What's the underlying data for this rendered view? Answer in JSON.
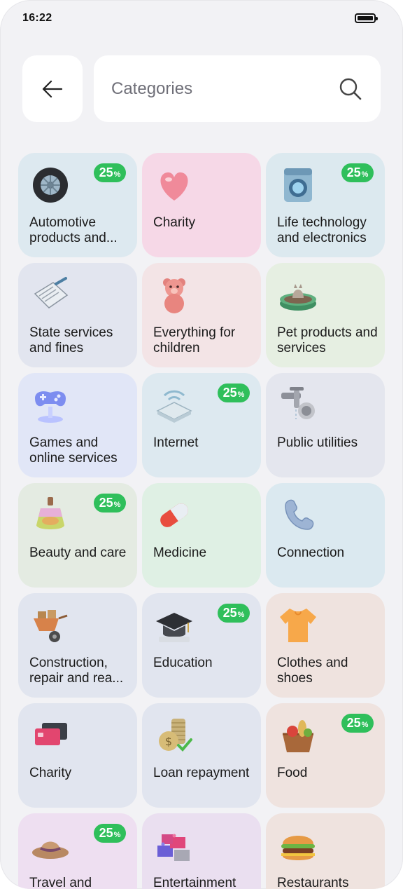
{
  "status_bar": {
    "time": "16:22"
  },
  "header": {
    "search_placeholder": "Categories"
  },
  "categories": [
    {
      "label": "Automotive products and...",
      "badge": "25",
      "badge_unit": "%",
      "bg": "#dde9f0",
      "icon": "tire-icon"
    },
    {
      "label": "Charity",
      "bg": "#f6d8e7",
      "icon": "heart-icon"
    },
    {
      "label": "Life technology and electronics",
      "badge": "25",
      "badge_unit": "%",
      "bg": "#dce9ef",
      "icon": "washing-machine-icon"
    },
    {
      "label": "State services and fines",
      "bg": "#e2e5ef",
      "icon": "document-pen-icon"
    },
    {
      "label": "Everything for children",
      "bg": "#f3e4e6",
      "icon": "teddy-bear-icon"
    },
    {
      "label": "Pet products and services",
      "bg": "#e6efe2",
      "icon": "pet-bowl-icon"
    },
    {
      "label": "Games and online services",
      "bg": "#e1e6f7",
      "icon": "gamepad-icon"
    },
    {
      "label": "Internet",
      "badge": "25",
      "badge_unit": "%",
      "bg": "#dde9f0",
      "icon": "router-icon"
    },
    {
      "label": "Public utilities",
      "bg": "#e4e6ee",
      "icon": "faucet-icon"
    },
    {
      "label": "Beauty and care",
      "badge": "25",
      "badge_unit": "%",
      "bg": "#e4ebe2",
      "icon": "perfume-icon"
    },
    {
      "label": "Medicine",
      "bg": "#dff0e4",
      "icon": "pills-icon"
    },
    {
      "label": "Connection",
      "bg": "#dbe9f0",
      "icon": "phone-handset-icon"
    },
    {
      "label": "Construction, repair and rea...",
      "bg": "#e1e5ef",
      "icon": "wheelbarrow-icon"
    },
    {
      "label": "Education",
      "badge": "25",
      "badge_unit": "%",
      "bg": "#e1e5ef",
      "icon": "graduation-cap-icon"
    },
    {
      "label": "Clothes and shoes",
      "bg": "#efe3df",
      "icon": "tshirt-icon"
    },
    {
      "label": "Charity",
      "bg": "#e1e5ef",
      "icon": "cards-icon"
    },
    {
      "label": "Loan repayment",
      "bg": "#e1e5ef",
      "icon": "coins-icon"
    },
    {
      "label": "Food",
      "badge": "25",
      "badge_unit": "%",
      "bg": "#efe3df",
      "icon": "food-basket-icon"
    },
    {
      "label": "Travel and",
      "badge": "25",
      "badge_unit": "%",
      "bg": "#eedff1",
      "icon": "hat-icon"
    },
    {
      "label": "Entertainment",
      "bg": "#eadff0",
      "icon": "blocks-icon"
    },
    {
      "label": "Restaurants",
      "bg": "#efe3df",
      "icon": "burger-icon"
    }
  ]
}
